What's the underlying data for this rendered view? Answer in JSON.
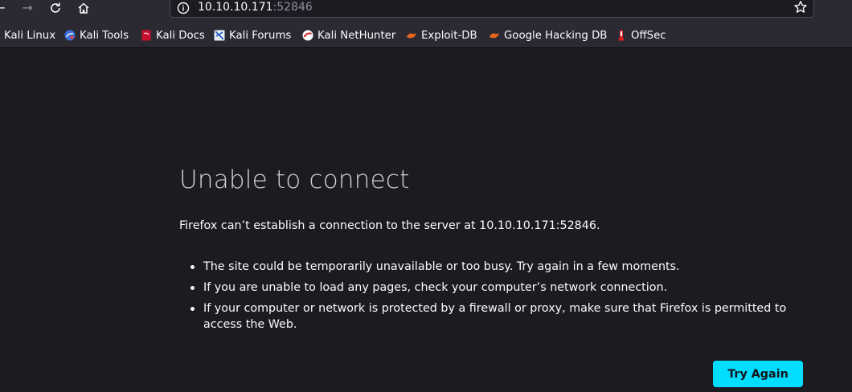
{
  "browser": {
    "nav": {
      "back_glyph": "←",
      "forward_glyph": "→"
    },
    "url": {
      "host": "10.10.10.171",
      "port": ":52846"
    },
    "bookmarks": [
      {
        "label": "Kali Linux",
        "icon": "kali-icon"
      },
      {
        "label": "Kali Tools",
        "icon": "kali-tools-icon"
      },
      {
        "label": "Kali Docs",
        "icon": "kali-docs-icon"
      },
      {
        "label": "Kali Forums",
        "icon": "kali-forums-icon"
      },
      {
        "label": "Kali NetHunter",
        "icon": "nethunter-icon"
      },
      {
        "label": "Exploit-DB",
        "icon": "exploit-db-icon"
      },
      {
        "label": "Google Hacking DB",
        "icon": "ghdb-icon"
      },
      {
        "label": "OffSec",
        "icon": "offsec-icon"
      }
    ]
  },
  "error": {
    "title": "Unable to connect",
    "description": "Firefox can’t establish a connection to the server at 10.10.10.171:52846.",
    "reasons": [
      "The site could be temporarily unavailable or too busy. Try again in a few moments.",
      "If you are unable to load any pages, check your computer’s network connection.",
      "If your computer or network is protected by a firewall or proxy, make sure that Firefox is permitted to access the Web."
    ],
    "button_label": "Try Again"
  },
  "colors": {
    "background": "#1c1b22",
    "toolbar": "#2b2a33",
    "accent": "#00ddff"
  }
}
